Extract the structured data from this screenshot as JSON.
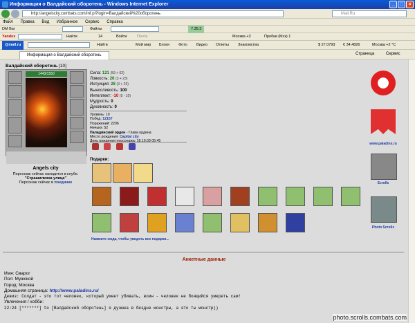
{
  "window": {
    "title": "Информация о Валдайский оборотень - Windows Internet Explorer"
  },
  "address": {
    "url": "http://angelscity.combats.com/inf.pl?login=Валдайский%20оборотень",
    "search_placeholder": "Mail.Ru"
  },
  "menu": {
    "items": [
      "Файл",
      "Правка",
      "Вид",
      "Избранное",
      "Сервис",
      "Справка"
    ]
  },
  "toolbar1": {
    "brand": "DM Bar",
    "files": "Файлы",
    "price": "7.35.3"
  },
  "toolbar2": {
    "brand": "Yandex",
    "find": "Найти",
    "count": "14",
    "enter": "Войти",
    "mail": "Почта",
    "weather": "Москва +3",
    "traffic": "Пробки (Мск) 1"
  },
  "toolbar3": {
    "brand": "@mail.ru",
    "find": "Найти",
    "items": [
      "Мой мир",
      "Блоги",
      "Фото",
      "Видео",
      "Ответы",
      "Знакомства"
    ],
    "usd": "$ 27.0793",
    "eur": "€ 34.4826",
    "weather": "Москва +2 °C"
  },
  "tab": {
    "label": "Информация о Валдайский оборотень",
    "page_menu": "Страница",
    "tools_menu": "Сервис"
  },
  "character": {
    "name": "Валдайский оборотень",
    "level": "[10]",
    "hp": "1443/1550",
    "clan": "Angels city",
    "club_note": "Персонаж сейчас находится в клубе.",
    "location": "\"Страшилкина улица\"",
    "status_prefix": "Персонаж сейчас в",
    "status_link": "поединке"
  },
  "stats": [
    {
      "label": "Сила:",
      "value": "121",
      "extra": "(59 + 62)",
      "color": "g"
    },
    {
      "label": "Ловкость:",
      "value": "26",
      "extra": "(3 + 23)",
      "color": "g"
    },
    {
      "label": "Интуиция:",
      "value": "28",
      "extra": "(3 + 25)",
      "color": "g"
    },
    {
      "label": "Выносливость:",
      "value": "100",
      "extra": "",
      "color": ""
    },
    {
      "label": "Интеллект:",
      "value": "-10",
      "extra": "(0 - 10)",
      "color": "r"
    },
    {
      "label": "Мудрость:",
      "value": "0",
      "extra": "",
      "color": ""
    },
    {
      "label": "Духовность:",
      "value": "0",
      "extra": "",
      "color": ""
    }
  ],
  "info": {
    "levels": "Уровень: 10",
    "wins_label": "Побед:",
    "wins": "12157",
    "losses": "Поражений: 2206",
    "draws": "Ничьих: 52",
    "order": "Паладинский орден",
    "order_rank": "- Глава ордена",
    "birth_label": "Место рождения:",
    "birth": "Capital city",
    "birthday": "День рождения персонажа: 18.10.03 05:45"
  },
  "gifts": {
    "label": "Подарки:",
    "more": "Нажмите сюда, чтобы увидеть все подарки..."
  },
  "logos": {
    "paladins": "www.paladins.ru",
    "scrolls": "Scrolls",
    "photo": "Photo Scrolls"
  },
  "profile": {
    "heading": "Анкетные данные",
    "name": "Имя: Сварог",
    "gender": "Пол: Мужской",
    "city": "Город: Москва",
    "homepage_label": "Домашняя страница:",
    "homepage": "http://www.paladins.ru/",
    "motto": "Девиз: Солдат - это тот человек, который умеет убивать, воин - человек не боящийся умереть сам!",
    "hobbies": "Увлечения / хобби:",
    "chat": "22:24 [*******] to [Валдайский оборотень] я дуэшка в бездне монстры, а это ты монстр))"
  },
  "watermark": "photo.scrolls.combats.com"
}
